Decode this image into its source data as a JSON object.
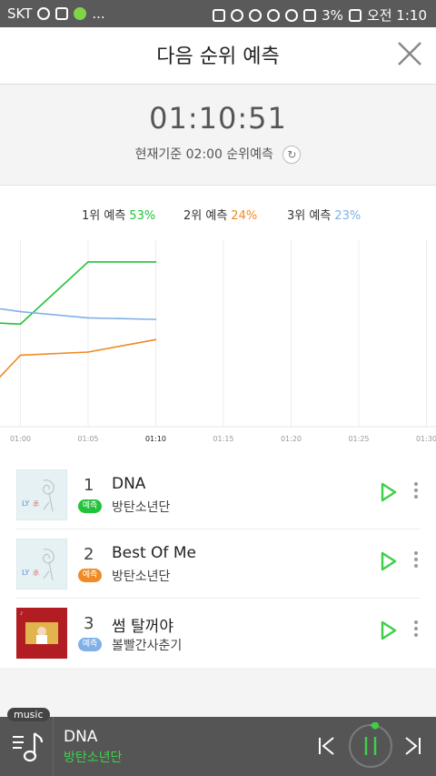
{
  "status_bar": {
    "carrier": "SKT",
    "dots": "...",
    "battery": "3%",
    "time": "오전 1:10"
  },
  "header": {
    "title": "다음 순위 예측",
    "close_icon": "close-icon"
  },
  "countdown": {
    "time": "01:10:51",
    "sub": "현재기준 02:00 순위예측",
    "refresh_icon": "refresh-icon"
  },
  "legend": [
    {
      "label": "1위 예측",
      "pct": "53%",
      "color": "#22c23a"
    },
    {
      "label": "2위 예측",
      "pct": "24%",
      "color": "#f08a24"
    },
    {
      "label": "3위 예측",
      "pct": "23%",
      "color": "#7fb0e8"
    }
  ],
  "chart_data": {
    "type": "line",
    "x": [
      "",
      "01:00",
      "01:05",
      "01:10",
      "01:15",
      "01:20",
      "01:25",
      "01:30"
    ],
    "xcurrent": "01:10",
    "ylim": [
      0,
      60
    ],
    "series": [
      {
        "name": "1위 예측",
        "color": "#22c23a",
        "values": [
          34,
          33,
          53,
          53
        ]
      },
      {
        "name": "2위 예측",
        "color": "#f08a24",
        "values": [
          0,
          23,
          24,
          28
        ]
      },
      {
        "name": "3위 예측",
        "color": "#7fb0e8",
        "values": [
          40,
          37,
          35,
          34.5
        ]
      }
    ],
    "grid": "vertical"
  },
  "ranks": [
    {
      "rank": "1",
      "title": "DNA",
      "artist": "방탄소년단",
      "badge": "예측",
      "badge_color": "#22c23a",
      "thumb": "album-cover-love-yourself"
    },
    {
      "rank": "2",
      "title": "Best Of Me",
      "artist": "방탄소년단",
      "badge": "예측",
      "badge_color": "#f08a24",
      "thumb": "album-cover-love-yourself"
    },
    {
      "rank": "3",
      "title": "썸 탈꺼야",
      "artist": "볼빨간사춘기",
      "badge": "예측",
      "badge_color": "#7fb0e8",
      "thumb": "album-cover-red"
    }
  ],
  "player": {
    "tag": "music",
    "title": "DNA",
    "artist": "방탄소년단",
    "accent": "#3fcf4a"
  }
}
